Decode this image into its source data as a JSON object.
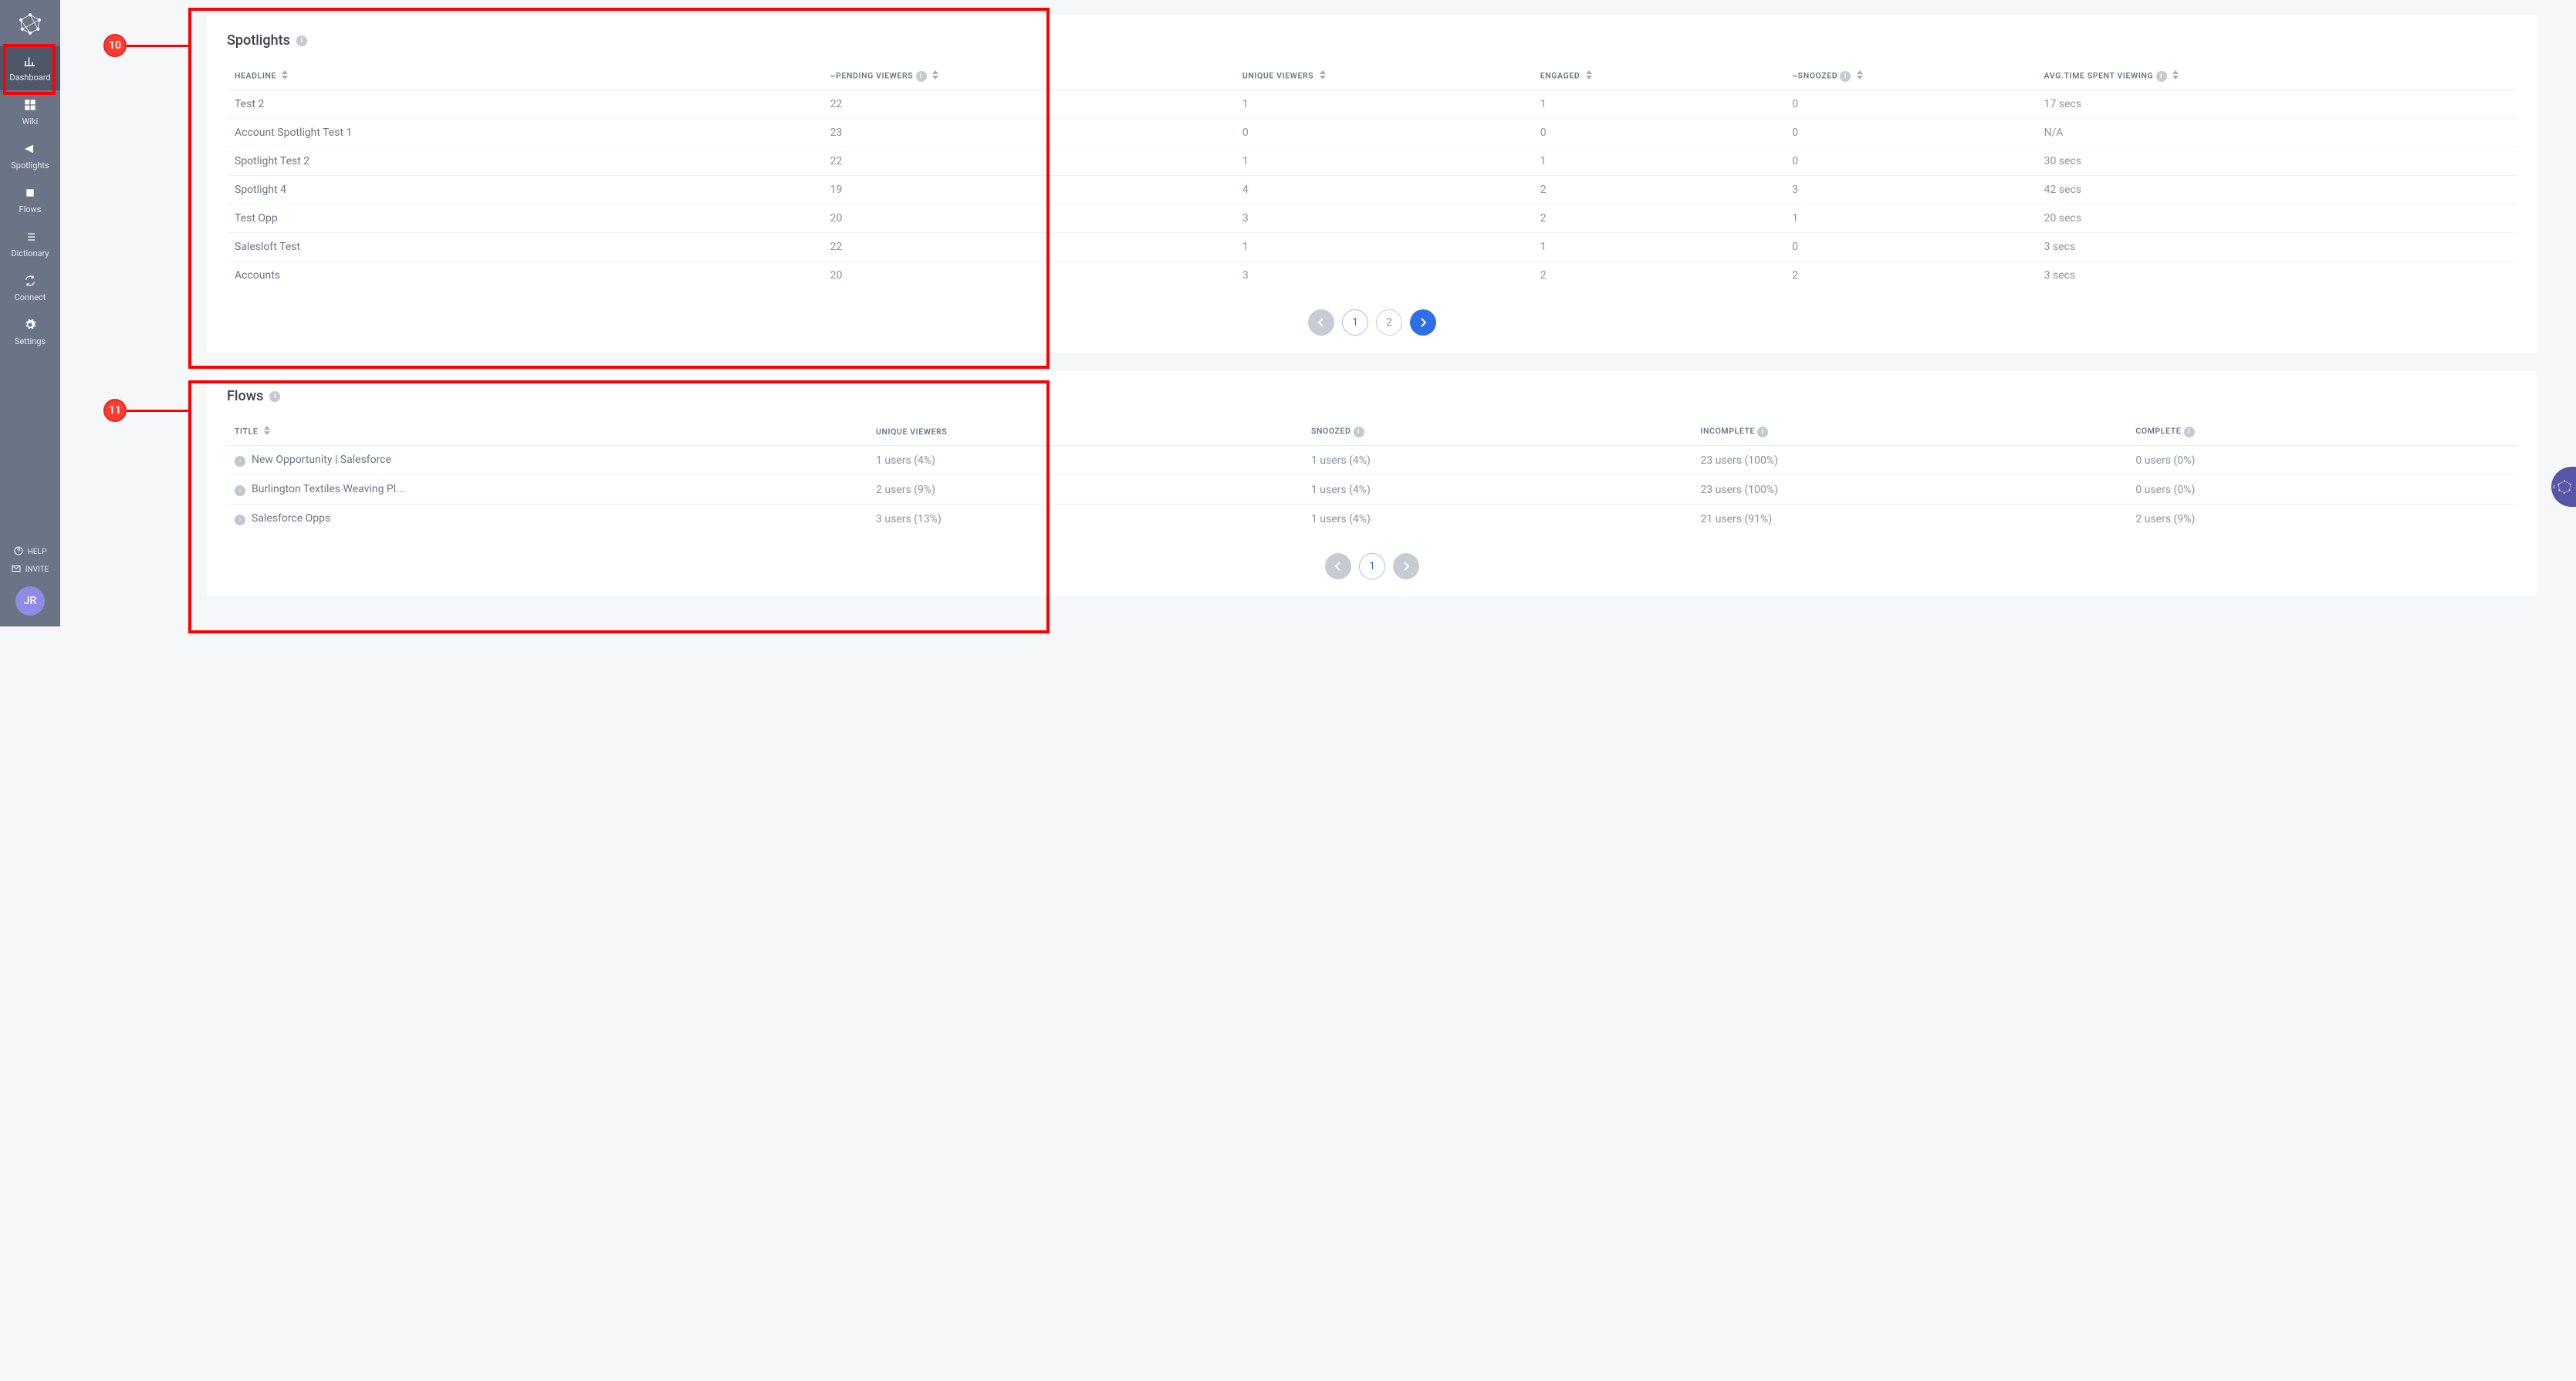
{
  "sidebar": {
    "items": [
      {
        "label": "Dashboard"
      },
      {
        "label": "Wiki"
      },
      {
        "label": "Spotlights"
      },
      {
        "label": "Flows"
      },
      {
        "label": "Dictionary"
      },
      {
        "label": "Connect"
      },
      {
        "label": "Settings"
      }
    ],
    "help_label": "HELP",
    "invite_label": "INVITE",
    "avatar_initials": "JR"
  },
  "annotations": {
    "badge10": "10",
    "badge11": "11"
  },
  "spotlights": {
    "title": "Spotlights",
    "headers": [
      "HEADLINE",
      "~PENDING VIEWERS",
      "UNIQUE VIEWERS",
      "ENGAGED",
      "~SNOOZED",
      "AVG.TIME SPENT VIEWING"
    ],
    "rows": [
      {
        "headline": "Test 2",
        "pending": "22",
        "unique": "1",
        "engaged": "1",
        "snoozed": "0",
        "avg": "17 secs"
      },
      {
        "headline": "Account Spotlight Test 1",
        "pending": "23",
        "unique": "0",
        "engaged": "0",
        "snoozed": "0",
        "avg": "N/A"
      },
      {
        "headline": "Spotlight Test 2",
        "pending": "22",
        "unique": "1",
        "engaged": "1",
        "snoozed": "0",
        "avg": "30 secs"
      },
      {
        "headline": "Spotlight 4",
        "pending": "19",
        "unique": "4",
        "engaged": "2",
        "snoozed": "3",
        "avg": "42 secs"
      },
      {
        "headline": "Test Opp",
        "pending": "20",
        "unique": "3",
        "engaged": "2",
        "snoozed": "1",
        "avg": "20 secs"
      },
      {
        "headline": "Salesloft Test",
        "pending": "22",
        "unique": "1",
        "engaged": "1",
        "snoozed": "0",
        "avg": "3 secs"
      },
      {
        "headline": "Accounts",
        "pending": "20",
        "unique": "3",
        "engaged": "2",
        "snoozed": "2",
        "avg": "3 secs"
      }
    ],
    "pages": [
      "1",
      "2"
    ]
  },
  "flows": {
    "title": "Flows",
    "headers": [
      "TITLE",
      "UNIQUE VIEWERS",
      "SNOOZED",
      "INCOMPLETE",
      "COMPLETE"
    ],
    "rows": [
      {
        "title": "New Opportunity | Salesforce",
        "unique": "1 users (4%)",
        "snoozed": "1 users (4%)",
        "incomplete": "23 users (100%)",
        "complete": "0 users (0%)"
      },
      {
        "title": "Burlington Textiles Weaving Pl...",
        "unique": "2 users (9%)",
        "snoozed": "1 users (4%)",
        "incomplete": "23 users (100%)",
        "complete": "0 users (0%)"
      },
      {
        "title": "Salesforce Opps",
        "unique": "3 users (13%)",
        "snoozed": "1 users (4%)",
        "incomplete": "21 users (91%)",
        "complete": "2 users (9%)"
      }
    ],
    "pages": [
      "1"
    ]
  }
}
